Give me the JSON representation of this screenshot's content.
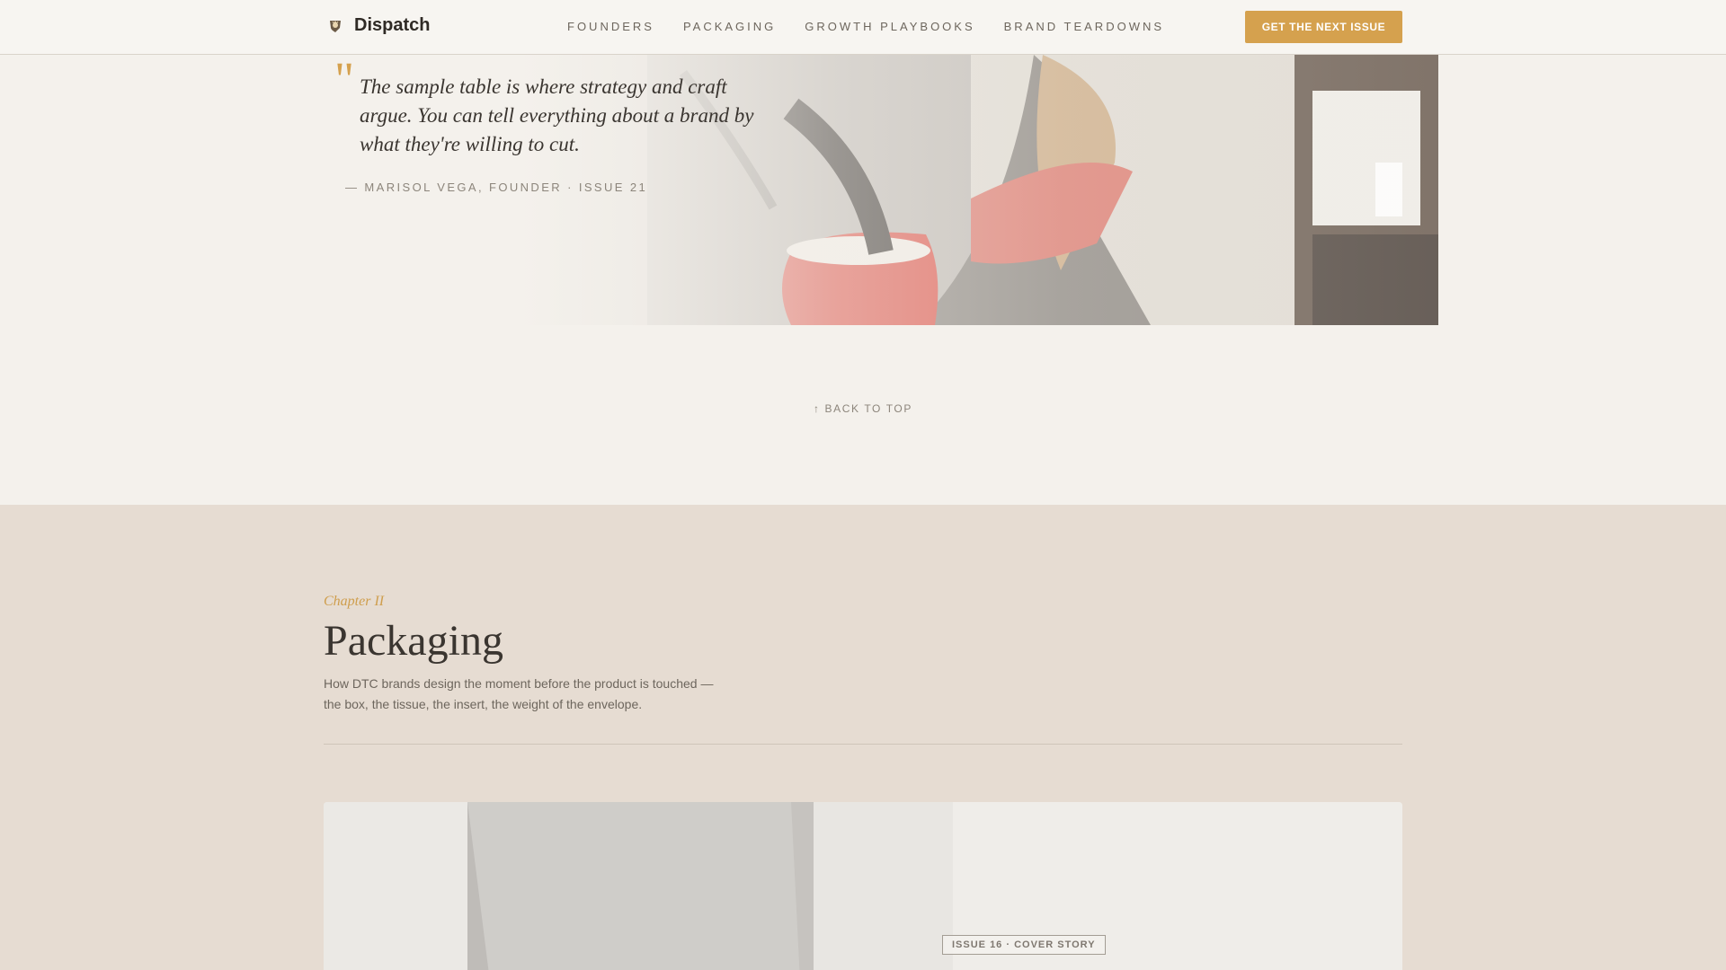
{
  "header": {
    "brand_name": "Dispatch",
    "logo_icon": "shield-crest-icon",
    "nav": [
      {
        "label": "FOUNDERS"
      },
      {
        "label": "PACKAGING"
      },
      {
        "label": "GROWTH PLAYBOOKS"
      },
      {
        "label": "BRAND TEARDOWNS"
      }
    ],
    "cta_label": "GET THE NEXT ISSUE",
    "accent_color": "#d5a14e"
  },
  "pull_quote": {
    "text": "The sample table is where strategy and craft argue. You can tell everything about a brand by what they're willing to cut.",
    "citation": "— MARISOL VEGA, FOUNDER · ISSUE 21"
  },
  "back_to_top": "↑ BACK TO TOP",
  "chapter": {
    "kicker": "Chapter II",
    "title": "Packaging",
    "description": "How DTC brands design the moment before the product is touched — the box, the tissue, the insert, the weight of the envelope.",
    "cover_badge": "ISSUE 16 · COVER STORY"
  }
}
